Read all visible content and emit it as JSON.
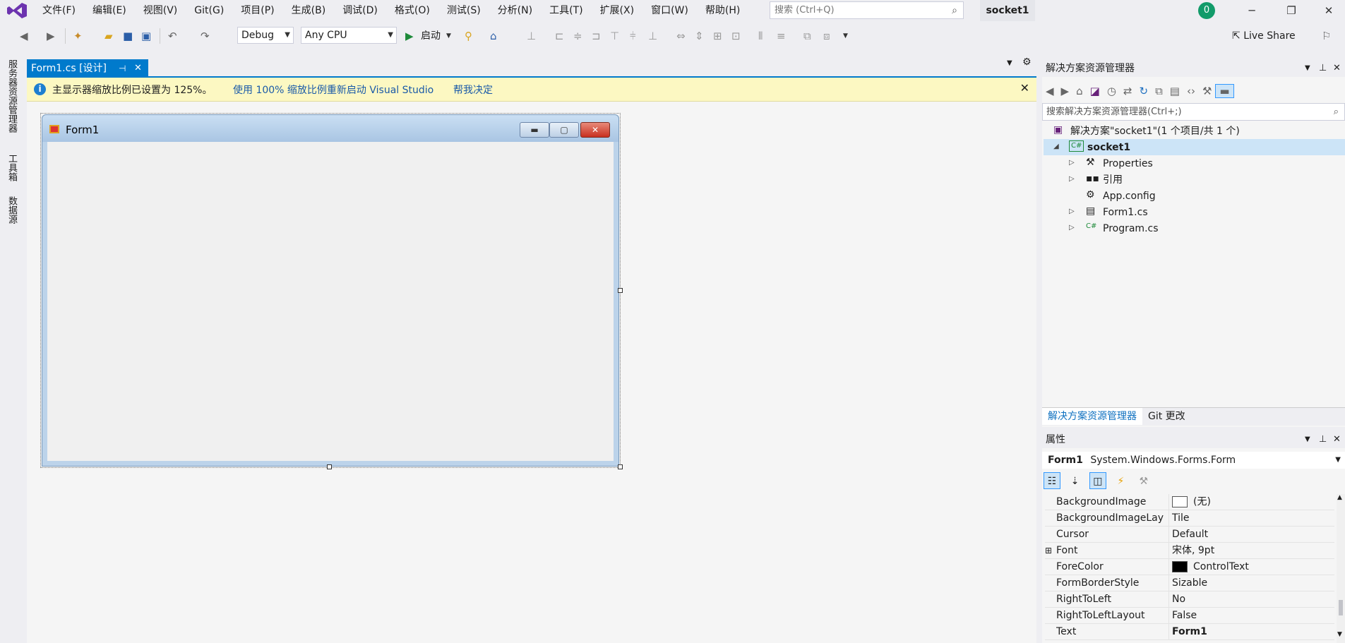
{
  "menu": [
    "文件(F)",
    "编辑(E)",
    "视图(V)",
    "Git(G)",
    "项目(P)",
    "生成(B)",
    "调试(D)",
    "格式(O)",
    "测试(S)",
    "分析(N)",
    "工具(T)",
    "扩展(X)",
    "窗口(W)",
    "帮助(H)"
  ],
  "search": {
    "placeholder": "搜索 (Ctrl+Q)"
  },
  "solution_tag": "socket1",
  "account_badge": "0",
  "toolbar": {
    "config": "Debug",
    "platform": "Any CPU",
    "start": "启动",
    "live_share": "Live Share"
  },
  "left_tabs": [
    "服务器资源管理器",
    "工具箱",
    "数据源"
  ],
  "doc_tab": {
    "title": "Form1.cs [设计]"
  },
  "infobar": {
    "message": "主显示器缩放比例已设置为 125%。",
    "link1": "使用 100% 缩放比例重新启动 Visual Studio",
    "link2": "帮我决定"
  },
  "form": {
    "title": "Form1"
  },
  "solution_explorer": {
    "title": "解决方案资源管理器",
    "search_placeholder": "搜索解决方案资源管理器(Ctrl+;)",
    "items": [
      {
        "label": "解决方案\"socket1\"(1 个项目/共 1 个)"
      },
      {
        "label": "socket1"
      },
      {
        "label": "Properties"
      },
      {
        "label": "引用"
      },
      {
        "label": "App.config"
      },
      {
        "label": "Form1.cs"
      },
      {
        "label": "Program.cs"
      }
    ],
    "tabs": [
      "解决方案资源管理器",
      "Git 更改"
    ]
  },
  "properties": {
    "title": "属性",
    "object_name": "Form1",
    "object_type": "System.Windows.Forms.Form",
    "rows": [
      {
        "name": "BackgroundImage",
        "value": "(无)"
      },
      {
        "name": "BackgroundImageLay",
        "value": "Tile"
      },
      {
        "name": "Cursor",
        "value": "Default"
      },
      {
        "name": "Font",
        "value": "宋体, 9pt"
      },
      {
        "name": "ForeColor",
        "value": "ControlText"
      },
      {
        "name": "FormBorderStyle",
        "value": "Sizable"
      },
      {
        "name": "RightToLeft",
        "value": "No"
      },
      {
        "name": "RightToLeftLayout",
        "value": "False"
      },
      {
        "name": "Text",
        "value": "Form1"
      }
    ]
  }
}
